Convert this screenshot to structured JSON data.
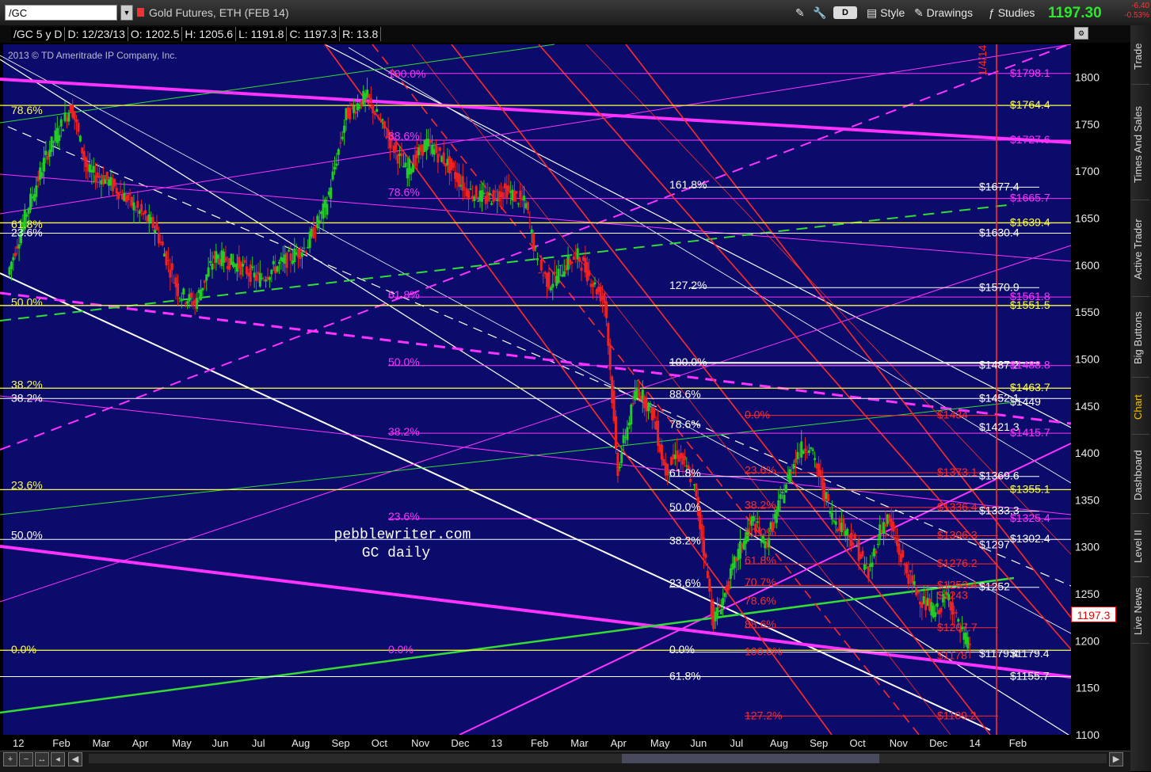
{
  "toolbar": {
    "symbol": "/GC",
    "description": "Gold Futures, ETH (FEB 14)",
    "d_button": "D",
    "style_label": "Style",
    "drawings_label": "Drawings",
    "studies_label": "Studies",
    "last_price": "1197.30",
    "change": "-6.40",
    "change_pct": "-0.53%"
  },
  "info_bar": {
    "title": "/GC 5 y D",
    "date": "D: 12/23/13",
    "open": "O: 1202.5",
    "high": "H: 1205.6",
    "low": "L: 1191.8",
    "close": "C: 1197.3",
    "range": "R: 13.8"
  },
  "right_tabs": [
    "Trade",
    "Times And Sales",
    "Active Trader",
    "Big Buttons",
    "Chart",
    "Dashboard",
    "Level II",
    "Live News"
  ],
  "active_tab": "Chart",
  "colors": {
    "background": "#0b0b6b",
    "candle_up": "#22cc22",
    "candle_down": "#ee2222",
    "magenta": "#ff33ff",
    "white": "#ffffff",
    "yellow": "#ffff44",
    "red": "#ff2a2a",
    "green": "#33dd33"
  },
  "chart_data": {
    "type": "candlestick",
    "copyright": "2013 © TD Ameritrade IP Company, Inc.",
    "annotation_line1": "pebblewriter.com",
    "annotation_line2": "GC daily",
    "current_price_tag": "1197.3",
    "ylim": [
      1100,
      1835
    ],
    "y_ticks": [
      1100,
      1150,
      1200,
      1250,
      1300,
      1350,
      1400,
      1450,
      1500,
      1550,
      1600,
      1650,
      1700,
      1750,
      1800
    ],
    "x_labels": [
      "12",
      "Feb",
      "Mar",
      "Apr",
      "May",
      "Jun",
      "Jul",
      "Aug",
      "Sep",
      "Oct",
      "Nov",
      "Dec",
      "13",
      "Feb",
      "Mar",
      "Apr",
      "May",
      "Jun",
      "Jul",
      "Aug",
      "Sep",
      "Oct",
      "Nov",
      "Dec",
      "14",
      "Feb"
    ],
    "x_range_months": [
      0,
      26
    ],
    "price_path": [
      [
        0.0,
        1590
      ],
      [
        0.5,
        1660
      ],
      [
        1.0,
        1720
      ],
      [
        1.6,
        1770
      ],
      [
        2.0,
        1700
      ],
      [
        2.5,
        1690
      ],
      [
        3.0,
        1670
      ],
      [
        3.7,
        1640
      ],
      [
        4.3,
        1570
      ],
      [
        4.7,
        1560
      ],
      [
        5.2,
        1610
      ],
      [
        5.8,
        1600
      ],
      [
        6.3,
        1585
      ],
      [
        6.8,
        1600
      ],
      [
        7.5,
        1620
      ],
      [
        8.0,
        1665
      ],
      [
        8.5,
        1760
      ],
      [
        9.0,
        1780
      ],
      [
        9.5,
        1740
      ],
      [
        10.0,
        1700
      ],
      [
        10.5,
        1730
      ],
      [
        11.0,
        1710
      ],
      [
        11.5,
        1680
      ],
      [
        12.0,
        1670
      ],
      [
        12.5,
        1680
      ],
      [
        13.0,
        1665
      ],
      [
        13.3,
        1600
      ],
      [
        13.6,
        1580
      ],
      [
        14.0,
        1600
      ],
      [
        14.3,
        1610
      ],
      [
        14.7,
        1580
      ],
      [
        15.0,
        1560
      ],
      [
        15.3,
        1380
      ],
      [
        15.5,
        1420
      ],
      [
        15.8,
        1470
      ],
      [
        16.2,
        1440
      ],
      [
        16.5,
        1380
      ],
      [
        16.8,
        1400
      ],
      [
        17.2,
        1370
      ],
      [
        17.5,
        1290
      ],
      [
        17.7,
        1220
      ],
      [
        18.0,
        1250
      ],
      [
        18.3,
        1290
      ],
      [
        18.7,
        1330
      ],
      [
        19.0,
        1300
      ],
      [
        19.4,
        1350
      ],
      [
        19.8,
        1400
      ],
      [
        20.1,
        1410
      ],
      [
        20.4,
        1370
      ],
      [
        20.7,
        1330
      ],
      [
        21.0,
        1320
      ],
      [
        21.3,
        1300
      ],
      [
        21.6,
        1270
      ],
      [
        21.9,
        1320
      ],
      [
        22.1,
        1330
      ],
      [
        22.4,
        1290
      ],
      [
        22.7,
        1260
      ],
      [
        23.0,
        1240
      ],
      [
        23.3,
        1230
      ],
      [
        23.6,
        1250
      ],
      [
        23.9,
        1210
      ],
      [
        24.1,
        1197
      ]
    ],
    "fib_labels": [
      {
        "text": "78.6%",
        "color": "yellow",
        "value": 1764
      },
      {
        "text": "61.8%",
        "color": "yellow",
        "value": 1643
      },
      {
        "text": "23.6%",
        "color": "white",
        "value": 1634
      },
      {
        "text": "50.0%",
        "color": "yellow",
        "value": 1560
      },
      {
        "text": "38.2%",
        "color": "yellow",
        "value": 1472
      },
      {
        "text": "38.2%",
        "color": "white",
        "value": 1458
      },
      {
        "text": "23.6%",
        "color": "yellow",
        "value": 1365
      },
      {
        "text": "50.0%",
        "color": "white",
        "value": 1312
      },
      {
        "text": "0.0%",
        "color": "yellow",
        "value": 1190
      },
      {
        "text": "61.8%",
        "color": "white",
        "value": 1162
      },
      {
        "text": "100.0%",
        "color": "magenta",
        "value": 1803
      },
      {
        "text": "88.6%",
        "color": "magenta",
        "value": 1737
      },
      {
        "text": "78.6%",
        "color": "magenta",
        "value": 1677
      },
      {
        "text": "61.8%",
        "color": "magenta",
        "value": 1568
      },
      {
        "text": "50.0%",
        "color": "magenta",
        "value": 1496
      },
      {
        "text": "38.2%",
        "color": "magenta",
        "value": 1422
      },
      {
        "text": "23.6%",
        "color": "magenta",
        "value": 1332
      },
      {
        "text": "0.0%",
        "color": "magenta",
        "value": 1190
      },
      {
        "text": "161.8%",
        "color": "white",
        "value": 1685
      },
      {
        "text": "127.2%",
        "color": "white",
        "value": 1578
      },
      {
        "text": "100.0%",
        "color": "white",
        "value": 1496
      },
      {
        "text": "88.6%",
        "color": "white",
        "value": 1462
      },
      {
        "text": "78.6%",
        "color": "white",
        "value": 1430
      },
      {
        "text": "61.8%",
        "color": "white",
        "value": 1378
      },
      {
        "text": "50.0%",
        "color": "white",
        "value": 1342
      },
      {
        "text": "38.2%",
        "color": "white",
        "value": 1306
      },
      {
        "text": "23.6%",
        "color": "white",
        "value": 1261
      },
      {
        "text": "0.0%",
        "color": "white",
        "value": 1190
      },
      {
        "text": "0.0%",
        "color": "red",
        "value": 1440
      },
      {
        "text": "23.6%",
        "color": "red",
        "value": 1381
      },
      {
        "text": "38.2%",
        "color": "red",
        "value": 1344
      },
      {
        "text": "50.0%",
        "color": "red",
        "value": 1315
      },
      {
        "text": "61.8%",
        "color": "red",
        "value": 1285
      },
      {
        "text": "70.7%",
        "color": "red",
        "value": 1262
      },
      {
        "text": "78.6%",
        "color": "red",
        "value": 1242
      },
      {
        "text": "88.6%",
        "color": "red",
        "value": 1217
      },
      {
        "text": "100.0%",
        "color": "red",
        "value": 1188
      },
      {
        "text": "127.2%",
        "color": "red",
        "value": 1120
      }
    ],
    "level_labels": [
      {
        "text": "$1798.1",
        "color": "magenta",
        "value": 1804
      },
      {
        "text": "$1764.4",
        "color": "yellow",
        "value": 1770
      },
      {
        "text": "$1727.6",
        "color": "magenta",
        "value": 1733
      },
      {
        "text": "$1677.4",
        "color": "white",
        "value": 1683
      },
      {
        "text": "$1665.7",
        "color": "magenta",
        "value": 1671
      },
      {
        "text": "$1639.4",
        "color": "yellow",
        "value": 1645
      },
      {
        "text": "$1630.4",
        "color": "white",
        "value": 1634
      },
      {
        "text": "$1570.9",
        "color": "white",
        "value": 1576
      },
      {
        "text": "$1561.8",
        "color": "magenta",
        "value": 1566
      },
      {
        "text": "$1551.5",
        "color": "yellow",
        "value": 1557
      },
      {
        "text": "$1487.2",
        "color": "white",
        "value": 1493
      },
      {
        "text": "$1488.8",
        "color": "magenta",
        "value": 1493
      },
      {
        "text": "$1463.7",
        "color": "yellow",
        "value": 1469
      },
      {
        "text": "$1452.1",
        "color": "white",
        "value": 1458
      },
      {
        "text": "$1449",
        "color": "white",
        "value": 1454
      },
      {
        "text": "$1434",
        "color": "red",
        "value": 1440
      },
      {
        "text": "$1421.3",
        "color": "white",
        "value": 1427
      },
      {
        "text": "$1415.7",
        "color": "magenta",
        "value": 1421
      },
      {
        "text": "$1373.1",
        "color": "red",
        "value": 1379
      },
      {
        "text": "$1369.6",
        "color": "white",
        "value": 1375
      },
      {
        "text": "$1355.1",
        "color": "yellow",
        "value": 1361
      },
      {
        "text": "$1336.4",
        "color": "red",
        "value": 1342
      },
      {
        "text": "$1333.3",
        "color": "white",
        "value": 1338
      },
      {
        "text": "$1325.4",
        "color": "magenta",
        "value": 1330
      },
      {
        "text": "$1306.3",
        "color": "red",
        "value": 1312
      },
      {
        "text": "$1302.4",
        "color": "white",
        "value": 1308
      },
      {
        "text": "$1297",
        "color": "white",
        "value": 1302
      },
      {
        "text": "$1276.2",
        "color": "red",
        "value": 1282
      },
      {
        "text": "$1253.4",
        "color": "red",
        "value": 1259
      },
      {
        "text": "$1252",
        "color": "white",
        "value": 1257
      },
      {
        "text": "$1243",
        "color": "red",
        "value": 1248
      },
      {
        "text": "$1207.7",
        "color": "red",
        "value": 1214
      },
      {
        "text": "$1179.4",
        "color": "white",
        "value": 1186
      },
      {
        "text": "$1179.4",
        "color": "white",
        "value": 1186
      },
      {
        "text": "$1178",
        "color": "red",
        "value": 1184
      },
      {
        "text": "$1155.7",
        "color": "white",
        "value": 1162
      },
      {
        "text": "$1109.2",
        "color": "red",
        "value": 1120
      },
      {
        "text": "1/4/14",
        "color": "red",
        "value": 1805
      }
    ]
  }
}
